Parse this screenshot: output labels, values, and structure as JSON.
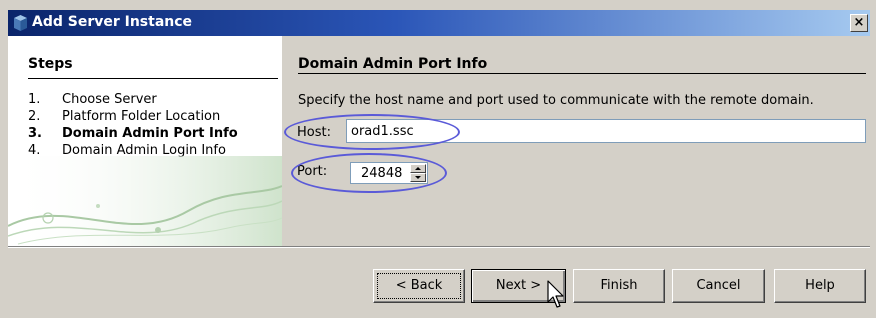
{
  "window": {
    "title": "Add Server Instance",
    "close_glyph": "×"
  },
  "steps": {
    "heading": "Steps",
    "items": [
      {
        "num": "1.",
        "label": "Choose Server"
      },
      {
        "num": "2.",
        "label": "Platform Folder Location"
      },
      {
        "num": "3.",
        "label": "Domain Admin Port Info",
        "current": true
      },
      {
        "num": "4.",
        "label": "Domain Admin Login Info"
      }
    ]
  },
  "panel": {
    "title": "Domain Admin Port Info",
    "instructions": "Specify the host name and port used to communicate with the remote domain.",
    "host": {
      "label": "Host:",
      "value": "orad1.ssc"
    },
    "port": {
      "label": "Port:",
      "value": "24848"
    }
  },
  "buttons": {
    "back": "< Back",
    "next": "Next >",
    "finish": "Finish",
    "cancel": "Cancel",
    "help": "Help"
  },
  "colors": {
    "title_gradient_start": "#0a246a",
    "title_gradient_end": "#a6caf0",
    "annotation_oval": "#5a5ad8",
    "dialog_bg": "#d4d0c8"
  },
  "icons": {
    "title": "server-cube-icon",
    "cursor": "mouse-pointer-icon"
  }
}
